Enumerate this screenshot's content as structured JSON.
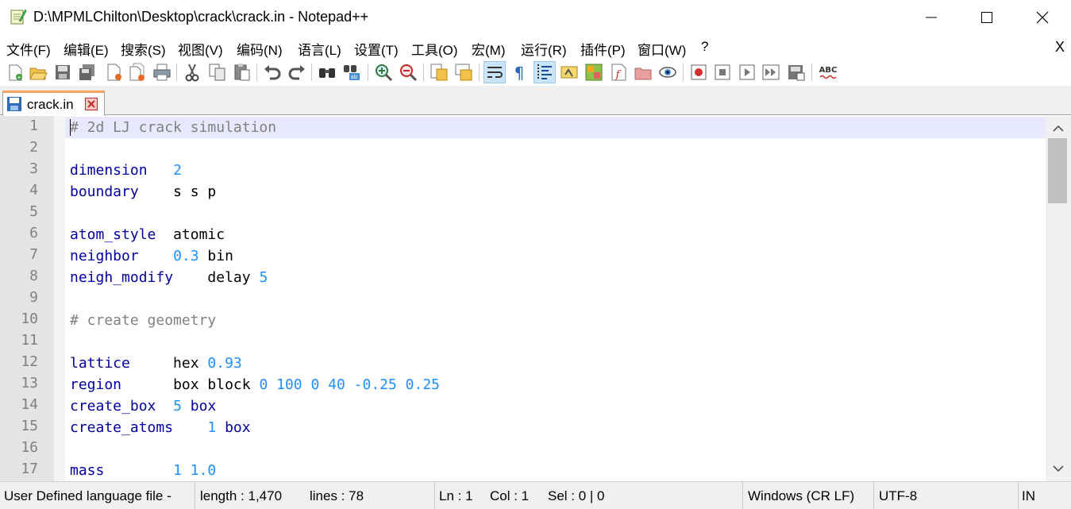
{
  "window": {
    "title": "D:\\MPMLChilton\\Desktop\\crack\\crack.in - Notepad++",
    "app_icon": "notepad-plus-plus-icon",
    "minimize_icon": "minimize-icon",
    "maximize_icon": "maximize-icon",
    "close_icon": "close-icon"
  },
  "menu": {
    "items": [
      "文件(F)",
      "编辑(E)",
      "搜索(S)",
      "视图(V)",
      "编码(N)",
      "语言(L)",
      "设置(T)",
      "工具(O)",
      "宏(M)",
      "运行(R)",
      "插件(P)",
      "窗口(W)",
      "?"
    ],
    "close_doc": "X"
  },
  "toolbar": {
    "icons": [
      "new-file-icon",
      "open-file-icon",
      "save-icon",
      "save-all-icon",
      "close-icon",
      "close-all-icon",
      "print-icon",
      "cut-icon",
      "copy-icon",
      "paste-icon",
      "undo-icon",
      "redo-icon",
      "find-icon",
      "replace-icon",
      "zoom-in-icon",
      "zoom-out-icon",
      "sync-vertical-icon",
      "sync-horizontal-icon",
      "word-wrap-icon",
      "show-all-characters-icon",
      "indent-guide-icon",
      "user-defined-language-icon",
      "document-map-icon",
      "function-list-icon",
      "folder-as-workspace-icon",
      "monitoring-icon",
      "record-macro-icon",
      "stop-macro-icon",
      "play-macro-icon",
      "run-macro-multiple-icon",
      "save-macro-icon",
      "spell-check-icon"
    ]
  },
  "tab": {
    "label": "crack.in",
    "icon": "saved-file-icon",
    "close_icon": "tab-close-icon"
  },
  "editor": {
    "line_numbers": [
      "1",
      "2",
      "3",
      "4",
      "5",
      "6",
      "7",
      "8",
      "9",
      "10",
      "11",
      "12",
      "13",
      "14",
      "15",
      "16",
      "17"
    ],
    "lines": [
      {
        "keyword": "",
        "comment": "# 2d LJ crack simulation",
        "text": "",
        "numbers": ""
      },
      {
        "keyword": "",
        "comment": "",
        "text": "",
        "numbers": ""
      },
      {
        "keyword": "dimension",
        "gap": "   ",
        "text": "",
        "numbers": "2"
      },
      {
        "keyword": "boundary",
        "gap": "    ",
        "text": "s s p",
        "numbers": ""
      },
      {
        "keyword": "",
        "comment": "",
        "text": "",
        "numbers": ""
      },
      {
        "keyword": "atom_style",
        "gap": "  ",
        "text": "atomic",
        "numbers": ""
      },
      {
        "keyword": "neighbor",
        "gap": "    ",
        "text": "",
        "numbers": "0.3",
        "text2": " bin"
      },
      {
        "keyword": "neigh_modify",
        "gap": "    ",
        "text": "delay ",
        "numbers": "5"
      },
      {
        "keyword": "",
        "comment": "",
        "text": "",
        "numbers": ""
      },
      {
        "keyword": "",
        "comment": "# create geometry",
        "text": "",
        "numbers": ""
      },
      {
        "keyword": "",
        "comment": "",
        "text": "",
        "numbers": ""
      },
      {
        "keyword": "lattice",
        "gap": "     ",
        "text": "hex ",
        "numbers": "0.93"
      },
      {
        "keyword": "region",
        "gap": "      ",
        "text": "box block ",
        "numbers": "0 100 0 40 -0.25 0.25"
      },
      {
        "keyword": "create_box",
        "gap": "  ",
        "text": "",
        "numbers": "5",
        "kw2": " box"
      },
      {
        "keyword": "create_atoms",
        "gap": "    ",
        "text": "",
        "numbers": "1",
        "kw2": " box"
      },
      {
        "keyword": "",
        "comment": "",
        "text": "",
        "numbers": ""
      },
      {
        "keyword": "mass",
        "gap": "        ",
        "text": "",
        "numbers": "1 1.0"
      }
    ]
  },
  "colors": {
    "keyword": "#00009f",
    "number": "#1e90ff",
    "comment": "#808080",
    "current_line": "#e8e8ff",
    "tab_accent": "#f4a460"
  },
  "status": {
    "file_type": "User Defined language file - ",
    "length": "length : 1,470",
    "lines": "lines : 78",
    "ln": "Ln : 1",
    "col": "Col : 1",
    "sel": "Sel : 0 | 0",
    "eol": "Windows (CR LF)",
    "encoding": "UTF-8",
    "mode": "IN"
  }
}
